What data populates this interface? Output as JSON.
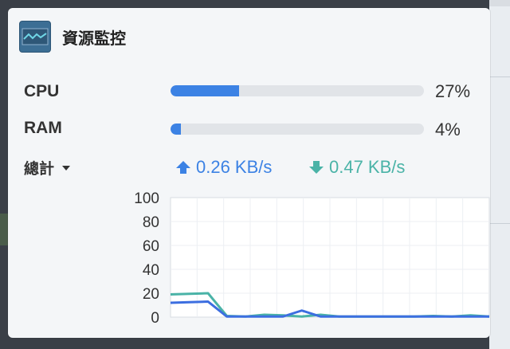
{
  "widget": {
    "title": "資源監控",
    "icon": "activity-monitor-icon"
  },
  "cpu": {
    "label": "CPU",
    "percent_text": "27%",
    "value": 27
  },
  "ram": {
    "label": "RAM",
    "percent_text": "4%",
    "value": 4
  },
  "network": {
    "scope_label": "總計",
    "upload": "0.26 KB/s",
    "download": "0.47 KB/s",
    "upload_color": "#3c82e4",
    "download_color": "#4ab3a7"
  },
  "chart_data": {
    "type": "line",
    "ylim": [
      0,
      100
    ],
    "yticks": [
      "100",
      "80",
      "60",
      "40",
      "20",
      "0"
    ],
    "grid": true,
    "x": [
      0,
      1,
      2,
      3,
      4,
      5,
      6,
      7,
      8,
      9,
      10,
      11,
      12,
      13,
      14,
      15,
      16,
      17
    ],
    "series": [
      {
        "color": "#4ab3a7",
        "values": [
          19,
          19.5,
          20,
          1,
          0.5,
          2,
          1.5,
          0.5,
          2,
          0.5,
          0.5,
          0.5,
          0.5,
          0.5,
          1,
          0.5,
          1.5,
          0.5
        ]
      },
      {
        "color": "#3c6ee0",
        "values": [
          12,
          12.5,
          13,
          0.5,
          0.5,
          0.5,
          0.5,
          5.5,
          0.5,
          0.5,
          0.5,
          0.5,
          0.5,
          0.5,
          0.5,
          0.5,
          0.5,
          0.5
        ]
      }
    ]
  }
}
